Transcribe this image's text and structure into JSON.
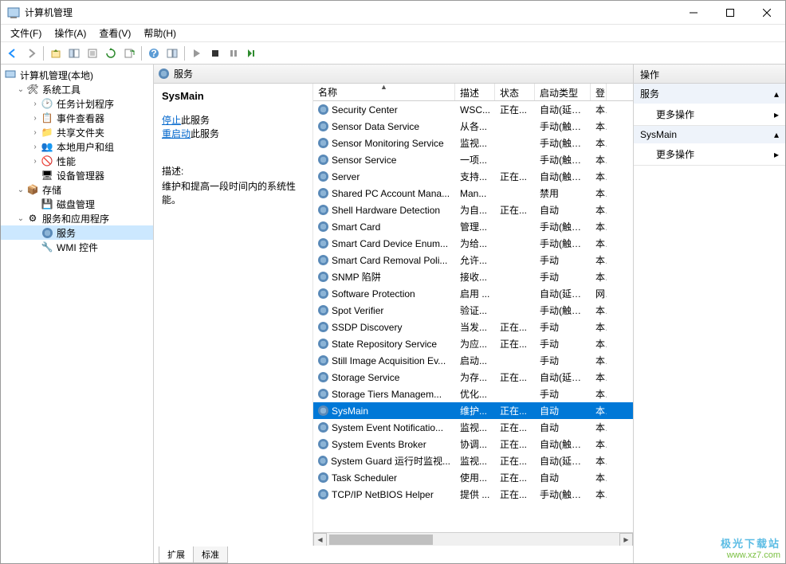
{
  "window": {
    "title": "计算机管理"
  },
  "menu": {
    "file": "文件(F)",
    "action": "操作(A)",
    "view": "查看(V)",
    "help": "帮助(H)"
  },
  "tree": {
    "root": "计算机管理(本地)",
    "system_tools": "系统工具",
    "task_scheduler": "任务计划程序",
    "event_viewer": "事件查看器",
    "shared_folders": "共享文件夹",
    "local_users": "本地用户和组",
    "performance": "性能",
    "device_manager": "设备管理器",
    "storage": "存储",
    "disk_mgmt": "磁盘管理",
    "services_apps": "服务和应用程序",
    "services": "服务",
    "wmi": "WMI 控件"
  },
  "center": {
    "header_title": "服务",
    "selected_name": "SysMain",
    "stop_prefix": "停止",
    "stop_suffix": "此服务",
    "restart_prefix": "重启动",
    "restart_suffix": "此服务",
    "desc_label": "描述:",
    "desc_text": "维护和提高一段时间内的系统性能。"
  },
  "columns": {
    "name": "名称",
    "desc": "描述",
    "status": "状态",
    "startup": "启动类型",
    "logon": "登"
  },
  "rows": [
    {
      "name": "Security Center",
      "desc": "WSC...",
      "status": "正在...",
      "startup": "自动(延迟...",
      "logon": "本"
    },
    {
      "name": "Sensor Data Service",
      "desc": "从各...",
      "status": "",
      "startup": "手动(触发...",
      "logon": "本"
    },
    {
      "name": "Sensor Monitoring Service",
      "desc": "监视...",
      "status": "",
      "startup": "手动(触发...",
      "logon": "本"
    },
    {
      "name": "Sensor Service",
      "desc": "一项...",
      "status": "",
      "startup": "手动(触发...",
      "logon": "本"
    },
    {
      "name": "Server",
      "desc": "支持...",
      "status": "正在...",
      "startup": "自动(触发...",
      "logon": "本"
    },
    {
      "name": "Shared PC Account Mana...",
      "desc": "Man...",
      "status": "",
      "startup": "禁用",
      "logon": "本"
    },
    {
      "name": "Shell Hardware Detection",
      "desc": "为自...",
      "status": "正在...",
      "startup": "自动",
      "logon": "本"
    },
    {
      "name": "Smart Card",
      "desc": "管理...",
      "status": "",
      "startup": "手动(触发...",
      "logon": "本"
    },
    {
      "name": "Smart Card Device Enum...",
      "desc": "为给...",
      "status": "",
      "startup": "手动(触发...",
      "logon": "本"
    },
    {
      "name": "Smart Card Removal Poli...",
      "desc": "允许...",
      "status": "",
      "startup": "手动",
      "logon": "本"
    },
    {
      "name": "SNMP 陷阱",
      "desc": "接收...",
      "status": "",
      "startup": "手动",
      "logon": "本"
    },
    {
      "name": "Software Protection",
      "desc": "启用 ...",
      "status": "",
      "startup": "自动(延迟...",
      "logon": "网"
    },
    {
      "name": "Spot Verifier",
      "desc": "验证...",
      "status": "",
      "startup": "手动(触发...",
      "logon": "本"
    },
    {
      "name": "SSDP Discovery",
      "desc": "当发...",
      "status": "正在...",
      "startup": "手动",
      "logon": "本"
    },
    {
      "name": "State Repository Service",
      "desc": "为应...",
      "status": "正在...",
      "startup": "手动",
      "logon": "本"
    },
    {
      "name": "Still Image Acquisition Ev...",
      "desc": "启动...",
      "status": "",
      "startup": "手动",
      "logon": "本"
    },
    {
      "name": "Storage Service",
      "desc": "为存...",
      "status": "正在...",
      "startup": "自动(延迟...",
      "logon": "本"
    },
    {
      "name": "Storage Tiers Managem...",
      "desc": "优化...",
      "status": "",
      "startup": "手动",
      "logon": "本"
    },
    {
      "name": "SysMain",
      "desc": "维护...",
      "status": "正在...",
      "startup": "自动",
      "logon": "本",
      "selected": true
    },
    {
      "name": "System Event Notificatio...",
      "desc": "监视...",
      "status": "正在...",
      "startup": "自动",
      "logon": "本"
    },
    {
      "name": "System Events Broker",
      "desc": "协调...",
      "status": "正在...",
      "startup": "自动(触发...",
      "logon": "本"
    },
    {
      "name": "System Guard 运行时监视...",
      "desc": "监视...",
      "status": "正在...",
      "startup": "自动(延迟...",
      "logon": "本"
    },
    {
      "name": "Task Scheduler",
      "desc": "使用...",
      "status": "正在...",
      "startup": "自动",
      "logon": "本"
    },
    {
      "name": "TCP/IP NetBIOS Helper",
      "desc": "提供 ...",
      "status": "正在...",
      "startup": "手动(触发...",
      "logon": "本"
    }
  ],
  "tabs": {
    "extended": "扩展",
    "standard": "标准"
  },
  "actions": {
    "header": "操作",
    "group1": "服务",
    "more": "更多操作",
    "group2": "SysMain"
  },
  "watermark": {
    "top": "极光下载站",
    "bot": "www.xz7.com"
  }
}
